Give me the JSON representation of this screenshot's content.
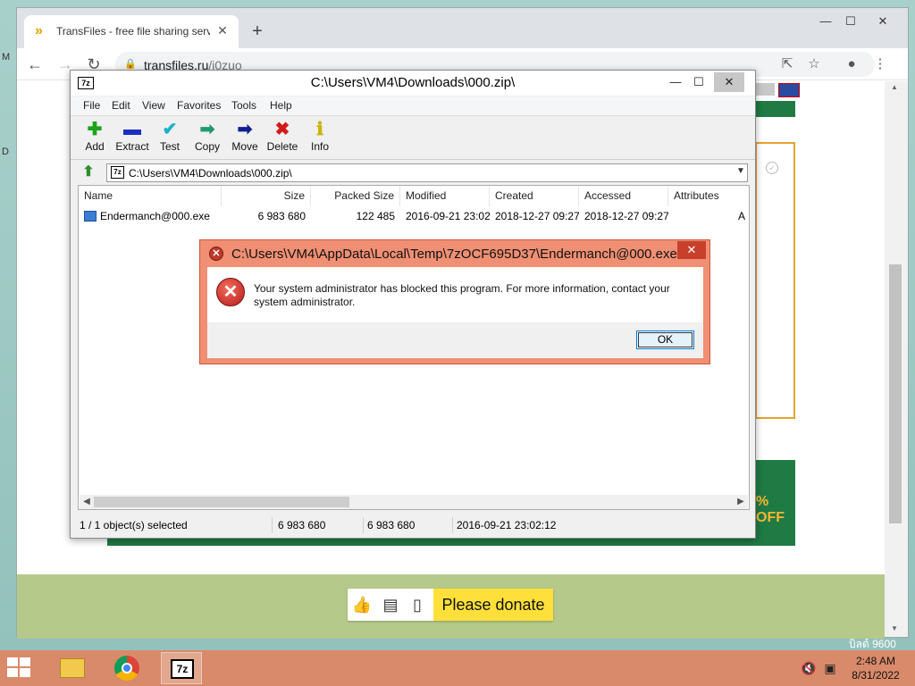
{
  "desktop": {
    "left_glyph_1": "M",
    "left_glyph_2": "D",
    "right_text": "บิลด์ 9600"
  },
  "chrome": {
    "tab_title": "TransFiles - free file sharing servi",
    "url_host": "transfiles.ru",
    "url_path": "/j0zuo",
    "donate_label": "Please donate",
    "offer_text": "% OFF"
  },
  "zip": {
    "title": "C:\\Users\\VM4\\Downloads\\000.zip\\",
    "menu": [
      "File",
      "Edit",
      "View",
      "Favorites",
      "Tools",
      "Help"
    ],
    "toolbar": [
      {
        "label": "Add",
        "icon": "add-icon",
        "glyph": "✚",
        "color": "#1aa31a"
      },
      {
        "label": "Extract",
        "icon": "extract-icon",
        "glyph": "▬",
        "color": "#1a2fbf"
      },
      {
        "label": "Test",
        "icon": "test-icon",
        "glyph": "✔",
        "color": "#19b3c9"
      },
      {
        "label": "Copy",
        "icon": "copy-icon",
        "glyph": "➡",
        "color": "#1e9a6e"
      },
      {
        "label": "Move",
        "icon": "move-icon",
        "glyph": "➡",
        "color": "#12208f"
      },
      {
        "label": "Delete",
        "icon": "delete-icon",
        "glyph": "✖",
        "color": "#d11a1a"
      },
      {
        "label": "Info",
        "icon": "info-icon",
        "glyph": "ℹ",
        "color": "#c8b400"
      }
    ],
    "path": "C:\\Users\\VM4\\Downloads\\000.zip\\",
    "columns": [
      "Name",
      "Size",
      "Packed Size",
      "Modified",
      "Created",
      "Accessed",
      "Attributes"
    ],
    "rows": [
      {
        "name": "Endermanch@000.exe",
        "size": "6 983 680",
        "packed": "122 485",
        "modified": "2016-09-21 23:02",
        "created": "2018-12-27 09:27",
        "accessed": "2018-12-27 09:27",
        "attributes": "A"
      }
    ],
    "status": {
      "selected": "1 / 1 object(s) selected",
      "size": "6 983 680",
      "packed": "6 983 680",
      "modified": "2016-09-21 23:02:12"
    }
  },
  "error": {
    "title": "C:\\Users\\VM4\\AppData\\Local\\Temp\\7zOCF695D37\\Endermanch@000.exe",
    "message": "Your system administrator has blocked this program. For more information, contact your system administrator.",
    "ok_label": "OK"
  },
  "taskbar": {
    "time": "2:48 AM",
    "date": "8/31/2022"
  }
}
